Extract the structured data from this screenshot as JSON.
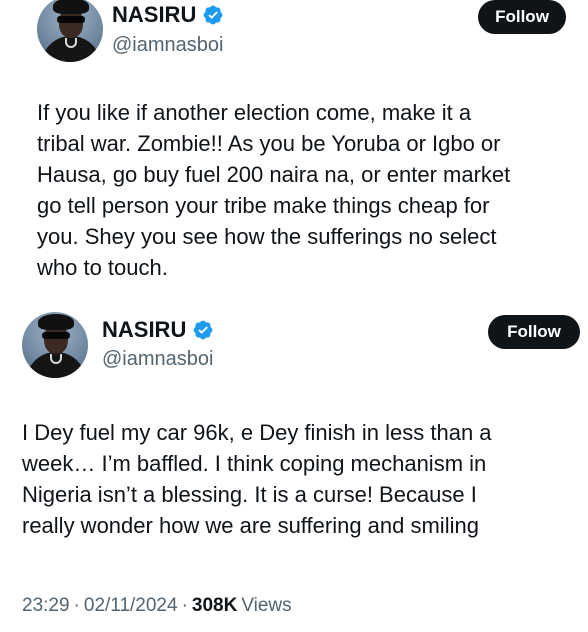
{
  "tweets": [
    {
      "author": {
        "name": "NASIRU",
        "handle": "@iamnasboi"
      },
      "follow_label": "Follow",
      "text": "If you like if another election come, make it a\ntribal war. Zombie!! As you be Yoruba or Igbo or\nHausa, go buy fuel 200 naira na, or enter market\ngo tell person your tribe make things cheap for\nyou. Shey you see how the sufferings no select\nwho to touch."
    },
    {
      "author": {
        "name": "NASIRU",
        "handle": "@iamnasboi"
      },
      "follow_label": "Follow",
      "text": "I Dey fuel my car 96k, e Dey finish in less than a\nweek… I’m baffled. I think coping mechanism in\nNigeria isn’t a blessing. It is a curse! Because I\nreally wonder how we are suffering and smiling",
      "meta": {
        "time": "23:29",
        "separator": "·",
        "date": "02/11/2024",
        "views_count": "308K",
        "views_label": "Views"
      }
    }
  ],
  "colors": {
    "verified_badge": "#1d9bf0",
    "follow_button_bg": "#0f1419",
    "secondary_text": "#536471"
  },
  "icons": {
    "verified": "verified-badge-icon"
  }
}
